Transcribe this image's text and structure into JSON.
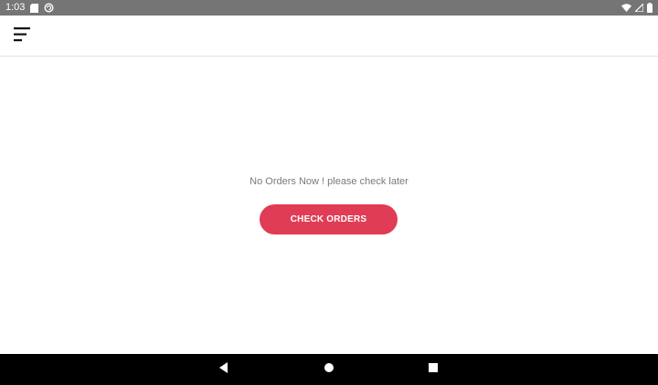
{
  "status_bar": {
    "time": "1:03",
    "icons": [
      "sd-card-icon",
      "sync-icon",
      "wifi-icon",
      "signal-icon",
      "battery-icon"
    ]
  },
  "app_bar": {
    "menu_icon": "menu-icon"
  },
  "main": {
    "empty_message": "No Orders Now ! please check later",
    "check_button_label": "CHECK ORDERS"
  },
  "nav_bar": {
    "icons": [
      "back-icon",
      "home-icon",
      "recents-icon"
    ]
  },
  "colors": {
    "status_bar_bg": "#757575",
    "accent": "#e03c55",
    "nav_bar_bg": "#000000",
    "message_text": "#7a7a7a"
  }
}
